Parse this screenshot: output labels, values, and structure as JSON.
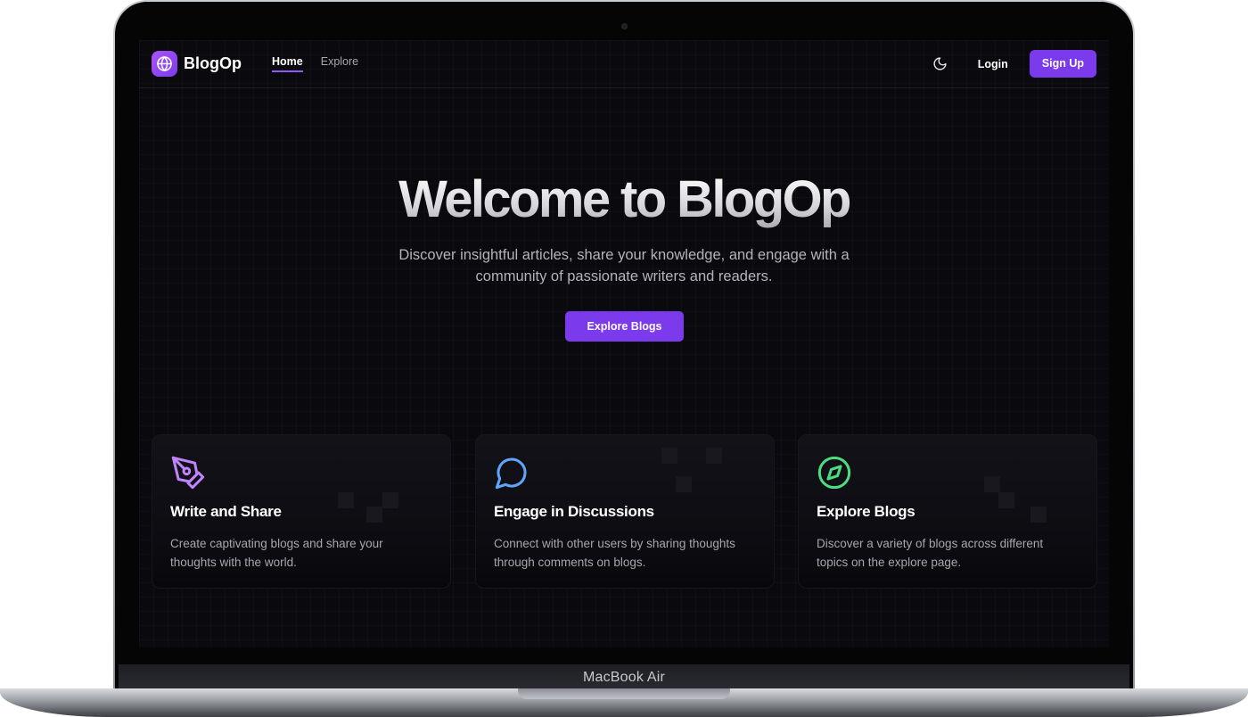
{
  "device": {
    "label": "MacBook Air"
  },
  "navbar": {
    "brand": "BlogOp",
    "links": [
      {
        "label": "Home",
        "active": true
      },
      {
        "label": "Explore",
        "active": false
      }
    ],
    "theme_toggle_icon": "moon-icon",
    "login_label": "Login",
    "signup_label": "Sign Up"
  },
  "hero": {
    "title": "Welcome to BlogOp",
    "subtitle": "Discover insightful articles, share your knowledge, and engage with a community of passionate writers and readers.",
    "cta_label": "Explore Blogs"
  },
  "features": [
    {
      "icon": "pen-nib-icon",
      "title": "Write and Share",
      "description": "Create captivating blogs and share your thoughts with the world.",
      "icon_color": "#c084fc"
    },
    {
      "icon": "chat-bubble-icon",
      "title": "Engage in Discussions",
      "description": "Connect with other users by sharing thoughts through comments on blogs.",
      "icon_color": "#60a5fa"
    },
    {
      "icon": "compass-icon",
      "title": "Explore Blogs",
      "description": "Discover a variety of blogs across different topics on the explore page.",
      "icon_color": "#4ade80"
    }
  ],
  "colors": {
    "accent": "#7c3aed",
    "background": "#0a090d"
  }
}
